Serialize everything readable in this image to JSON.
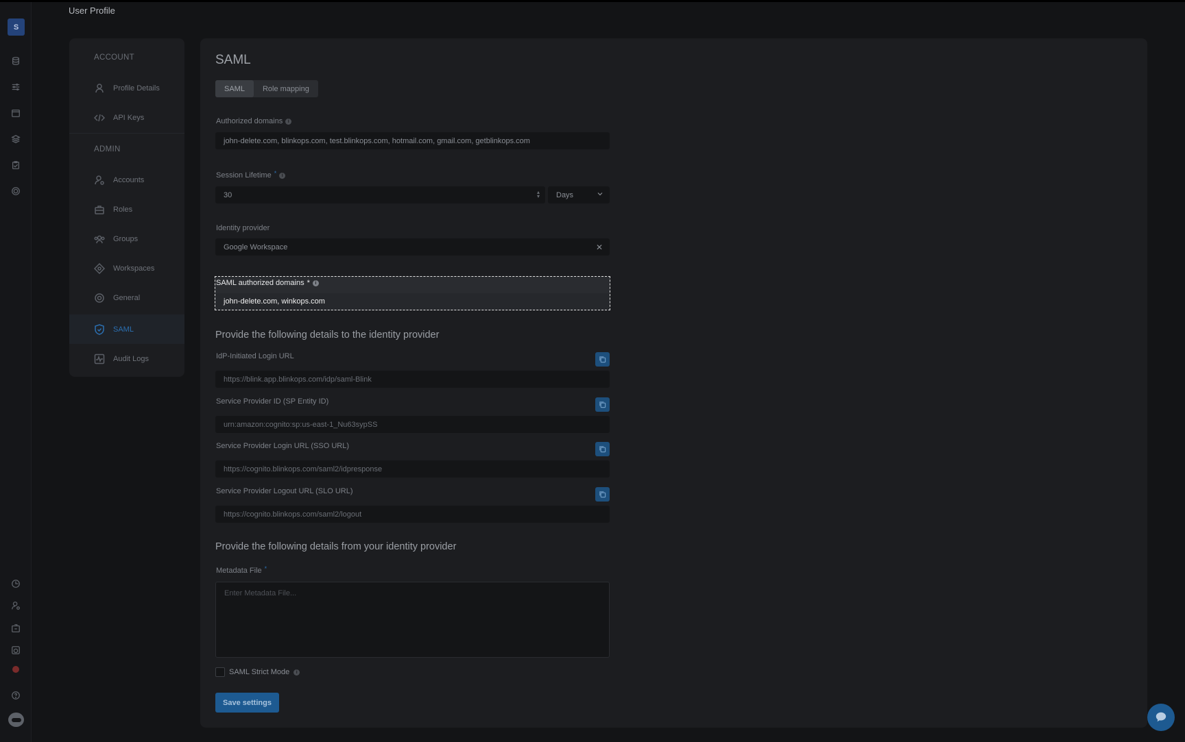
{
  "header": {
    "title": "User Profile"
  },
  "rail": {
    "logo": "S"
  },
  "nav": {
    "account_heading": "ACCOUNT",
    "admin_heading": "ADMIN",
    "items": [
      {
        "label": "Profile Details",
        "icon": "user-icon"
      },
      {
        "label": "API Keys",
        "icon": "code-icon"
      },
      {
        "label": "Accounts",
        "icon": "users-icon"
      },
      {
        "label": "Roles",
        "icon": "briefcase-icon"
      },
      {
        "label": "Groups",
        "icon": "group-icon"
      },
      {
        "label": "Workspaces",
        "icon": "workspace-icon"
      },
      {
        "label": "General",
        "icon": "gear-icon"
      },
      {
        "label": "SAML",
        "icon": "shield-icon",
        "active": true
      },
      {
        "label": "Audit Logs",
        "icon": "activity-icon"
      }
    ]
  },
  "main": {
    "title": "SAML",
    "tabs": [
      {
        "label": "SAML",
        "active": true
      },
      {
        "label": "Role mapping"
      }
    ],
    "authorized_domains": {
      "label": "Authorized domains",
      "value": "john-delete.com, blinkops.com, test.blinkops.com, hotmail.com, gmail.com, getblinkops.com"
    },
    "session_lifetime": {
      "label": "Session Lifetime",
      "required": "*",
      "value": "30",
      "unit": "Days"
    },
    "identity_provider": {
      "label": "Identity provider",
      "value": "Google Workspace"
    },
    "saml_domains": {
      "label": "SAML authorized domains",
      "required": "*",
      "value": "john-delete.com, winkops.com"
    },
    "provide_to_heading": "Provide the following details to the identity provider",
    "urls": [
      {
        "label": "IdP-Initiated Login URL",
        "value": "https://blink.app.blinkops.com/idp/saml-Blink"
      },
      {
        "label": "Service Provider ID (SP Entity ID)",
        "value": "urn:amazon:cognito:sp:us-east-1_Nu63sypSS"
      },
      {
        "label": "Service Provider Login URL (SSO URL)",
        "value": "https://cognito.blinkops.com/saml2/idpresponse"
      },
      {
        "label": "Service Provider Logout URL (SLO URL)",
        "value": "https://cognito.blinkops.com/saml2/logout"
      }
    ],
    "provide_from_heading": "Provide the following details from your identity provider",
    "metadata": {
      "label": "Metadata File",
      "required": "*",
      "placeholder": "Enter Metadata File..."
    },
    "strict_mode": {
      "label": "SAML Strict Mode",
      "checked": false
    },
    "save_label": "Save settings"
  },
  "colors": {
    "accent": "#1d5a91",
    "active_nav": "#2b6fb1",
    "background": "#131416",
    "panel": "#1c1d20"
  }
}
